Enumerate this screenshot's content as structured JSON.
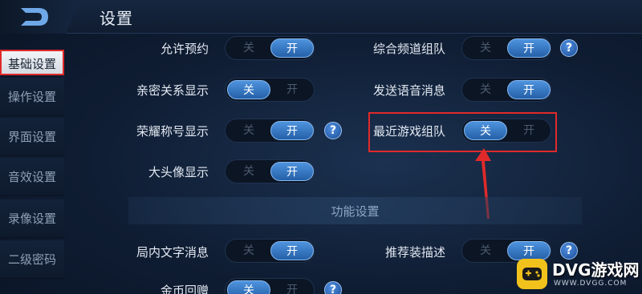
{
  "header": {
    "title": "设置"
  },
  "sidebar": {
    "items": [
      {
        "label": "基础设置"
      },
      {
        "label": "操作设置"
      },
      {
        "label": "界面设置"
      },
      {
        "label": "音效设置"
      },
      {
        "label": "录像设置"
      },
      {
        "label": "二级密码"
      }
    ]
  },
  "toggle_labels": {
    "off": "关",
    "on": "开"
  },
  "help_glyph": "?",
  "settings": {
    "allow_booking": {
      "label": "允许预约",
      "value": "开"
    },
    "intimate_display": {
      "label": "亲密关系显示",
      "value": "关"
    },
    "honor_title_display": {
      "label": "荣耀称号显示",
      "value": "开"
    },
    "big_avatar_display": {
      "label": "大头像显示",
      "value": "开"
    },
    "channel_team": {
      "label": "综合频道组队",
      "value": "开"
    },
    "send_voice": {
      "label": "发送语音消息",
      "value": "开"
    },
    "recent_game_team": {
      "label": "最近游戏组队",
      "value": "关"
    },
    "in_game_text": {
      "label": "局内文字消息",
      "value": "开"
    },
    "recommend_desc": {
      "label": "推荐装描述",
      "value": "开"
    },
    "gold_gift": {
      "label": "金币回赠",
      "value": "关"
    }
  },
  "section": {
    "title": "功能设置"
  },
  "watermark": {
    "text": "DVG游戏网",
    "sub": "WWW.DVGG.COM"
  },
  "colors": {
    "accent": "#2f74c4",
    "highlight": "#e02a2a",
    "watermark": "#f2c21c"
  }
}
